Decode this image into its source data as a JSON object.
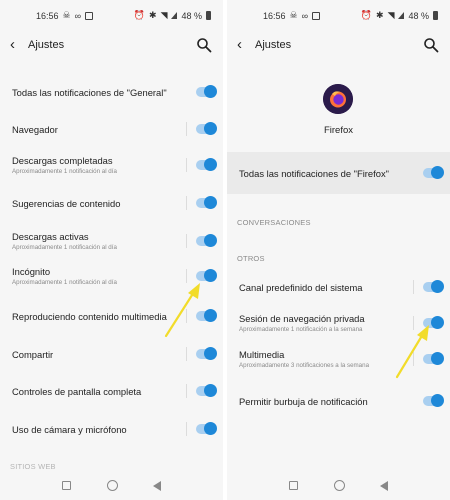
{
  "colors": {
    "accent": "#1e88d8",
    "track": "#a9cff0",
    "arrow": "#f2dc2a"
  },
  "status": {
    "time": "16:56",
    "battery": "48 %"
  },
  "left": {
    "title": "Ajustes",
    "items": [
      {
        "label": "Todas las notificaciones de \"General\"",
        "sub": "",
        "on": true
      },
      {
        "label": "Navegador",
        "sub": "",
        "on": true
      },
      {
        "label": "Descargas completadas",
        "sub": "Aproximadamente 1 notificación al día",
        "on": true
      },
      {
        "label": "Sugerencias de contenido",
        "sub": "",
        "on": true
      },
      {
        "label": "Descargas activas",
        "sub": "Aproximadamente 1 notificación al día",
        "on": true
      },
      {
        "label": "Incógnito",
        "sub": "Aproximadamente 1 notificación al día",
        "on": true
      },
      {
        "label": "Reproduciendo contenido multimedia",
        "sub": "",
        "on": true
      },
      {
        "label": "Compartir",
        "sub": "",
        "on": true
      },
      {
        "label": "Controles de pantalla completa",
        "sub": "",
        "on": true
      },
      {
        "label": "Uso de cámara y micrófono",
        "sub": "",
        "on": true
      }
    ],
    "cut_section": "SITIOS WEB"
  },
  "right": {
    "title": "Ajustes",
    "app_name": "Firefox",
    "all_notifications": "Todas las notificaciones de \"Firefox\"",
    "section_conversations": "CONVERSACIONES",
    "section_others": "OTROS",
    "items": [
      {
        "label": "Canal predefinido del sistema",
        "sub": "",
        "on": true
      },
      {
        "label": "Sesión de navegación privada",
        "sub": "Aproximadamente 1 notificación a la semana",
        "on": true
      },
      {
        "label": "Multimedia",
        "sub": "Aproximadamente 3 notificaciones a la semana",
        "on": true
      },
      {
        "label": "Permitir burbuja de notificación",
        "sub": "",
        "on": true
      }
    ]
  }
}
